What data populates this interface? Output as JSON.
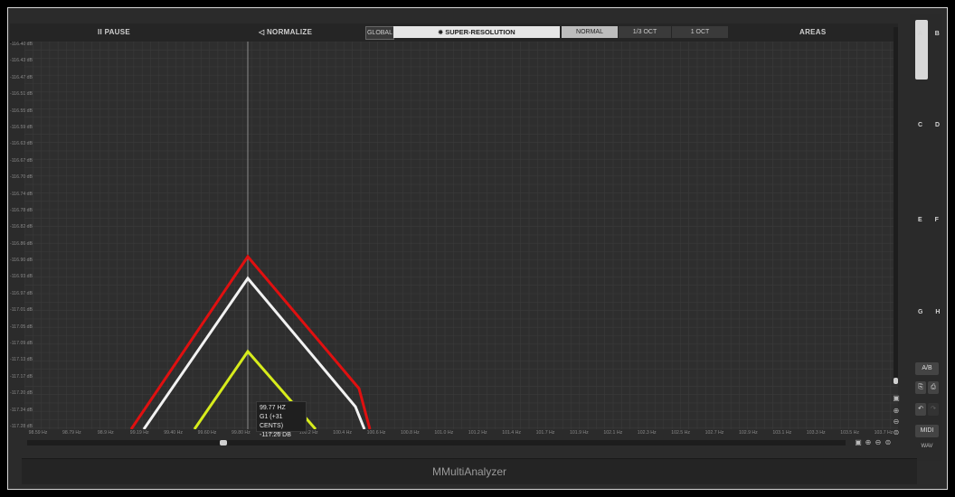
{
  "app_title": "MMultiAnalyzer",
  "toolbar": {
    "pause": "II PAUSE",
    "normalize": "◁ NORMALIZE",
    "global": "GLOBAL",
    "super_resolution": "SUPER-RESOLUTION",
    "normal": "NORMAL",
    "third_oct": "1/3 OCT",
    "one_oct": "1 OCT",
    "areas": "AREAS"
  },
  "y_labels": [
    "-116.40 dB",
    "-116.43 dB",
    "-116.47 dB",
    "-116.51 dB",
    "-116.55 dB",
    "-116.59 dB",
    "-116.63 dB",
    "-116.67 dB",
    "-116.70 dB",
    "-116.74 dB",
    "-116.78 dB",
    "-116.82 dB",
    "-116.86 dB",
    "-116.90 dB",
    "-116.93 dB",
    "-116.97 dB",
    "-117.01 dB",
    "-117.05 dB",
    "-117.09 dB",
    "-117.13 dB",
    "-117.17 dB",
    "-117.20 dB",
    "-117.24 dB",
    "-117.28 dB"
  ],
  "x_labels": [
    "98.59 Hz",
    "98.79 Hz",
    "98.9 Hz",
    "99.19 Hz",
    "99.40 Hz",
    "99.60 Hz",
    "99.80 Hz",
    "100 Hz",
    "100.2 Hz",
    "100.4 Hz",
    "100.6 Hz",
    "100.8 Hz",
    "101.0 Hz",
    "101.2 Hz",
    "101.4 Hz",
    "101.7 Hz",
    "101.9 Hz",
    "102.1 Hz",
    "102.3 Hz",
    "102.5 Hz",
    "102.7 Hz",
    "102.9 Hz",
    "103.1 Hz",
    "103.3 Hz",
    "103.5 Hz",
    "103.7 Hz"
  ],
  "tooltip": {
    "freq": "99.77 HZ",
    "note": "G1 (+31 CENTS)",
    "level": "-117.26 DB"
  },
  "cursor_freq_hz": 99.77,
  "spectrum": {
    "colors": {
      "red": "#e01010",
      "white": "#f2f2f2",
      "yellow": "#d7ec1c"
    },
    "red": {
      "peak_hz": 99.77,
      "peak_db": -116.88
    },
    "white": {
      "peak_hz": 99.77,
      "peak_db": -116.95
    },
    "yellow": {
      "peak_hz": 99.77,
      "peak_db": -117.1
    }
  },
  "sidebar": {
    "slots": [
      "A B",
      "C D",
      "E F",
      "G H"
    ],
    "ab_button": "A/B",
    "midi": "MIDI",
    "wav": "WAV"
  },
  "colors": {
    "background": "#2b2b2b",
    "grid": "#3b3b3b"
  }
}
